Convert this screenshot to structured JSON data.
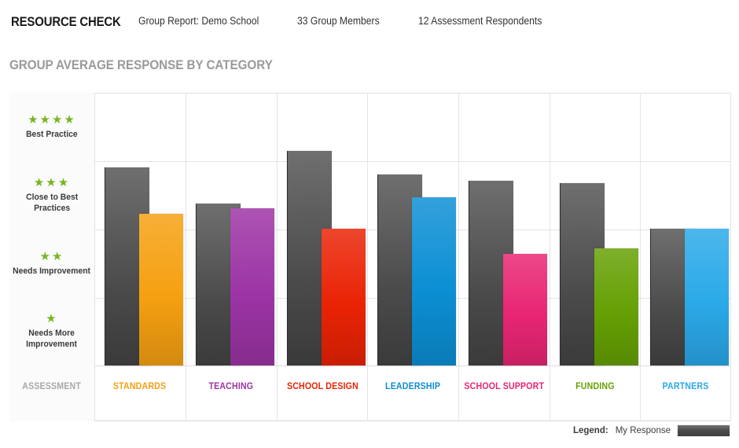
{
  "header": {
    "brand_title": "RESOURCE CHECK",
    "report_label": "Group Report: Demo School",
    "members_label": "33 Group Members",
    "respondents_label": "12 Assessment Respondents"
  },
  "section": {
    "title": "GROUP AVERAGE RESPONSE BY CATEGORY"
  },
  "axis": {
    "column_header": "ASSESSMENT",
    "bands": [
      {
        "stars": "★★★★",
        "star_count": 4,
        "label": "Best Practice"
      },
      {
        "stars": "★★★",
        "star_count": 3,
        "label": "Close to Best\nPractices"
      },
      {
        "stars": "★★",
        "star_count": 2,
        "label": "Needs Improvement"
      },
      {
        "stars": "★",
        "star_count": 1,
        "label": "Needs More\nImprovement"
      }
    ]
  },
  "legend": {
    "title": "Legend:",
    "item_label": "My Response",
    "swatch_color": "#4a4a4a"
  },
  "colors": {
    "group_bar": "#4a4a4a",
    "star": "#76b61e",
    "gridline": "#e4e4e4",
    "axis_column_bg": "#fbfbfb",
    "section_title": "#9a9a9a"
  },
  "chart_data": {
    "type": "bar",
    "title": "GROUP AVERAGE RESPONSE BY CATEGORY",
    "xlabel": "ASSESSMENT",
    "ylabel": "",
    "ylim": [
      0,
      4
    ],
    "grid": true,
    "legend_position": "bottom-right",
    "ytick_labels": [
      "Needs More Improvement",
      "Needs Improvement",
      "Close to Best Practices",
      "Best Practice"
    ],
    "ytick_values": [
      1,
      2,
      3,
      4
    ],
    "categories": [
      "STANDARDS",
      "TEACHING",
      "SCHOOL DESIGN",
      "LEADERSHIP",
      "SCHOOL SUPPORT",
      "FUNDING",
      "PARTNERS"
    ],
    "category_colors": [
      "#f5a011",
      "#9c34a5",
      "#ea2305",
      "#0c8fd4",
      "#e82573",
      "#65a004",
      "#2aa9e8"
    ],
    "series": [
      {
        "name": "Group Average",
        "color": "#4a4a4a",
        "values": [
          2.9,
          2.38,
          3.15,
          2.8,
          2.71,
          2.68,
          2.01
        ]
      },
      {
        "name": "My Response",
        "color": "category",
        "values": [
          2.23,
          2.3,
          2.01,
          2.47,
          1.64,
          1.72,
          2.01
        ]
      }
    ]
  }
}
